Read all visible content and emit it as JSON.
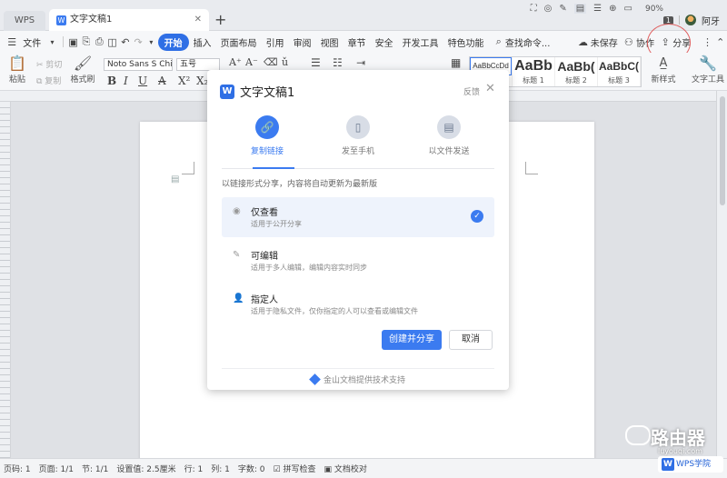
{
  "titlebar": {
    "app_tab": "WPS",
    "doc_tab": "文字文稿1",
    "new_tab": "+",
    "badge": "1",
    "user": "阿牙"
  },
  "menubar": {
    "file": "文件",
    "tabs": [
      "开始",
      "插入",
      "页面布局",
      "引用",
      "审阅",
      "视图",
      "章节",
      "安全",
      "开发工具",
      "特色功能"
    ],
    "search": "查找命令...",
    "unsaved": "未保存",
    "collab": "协作",
    "share": "分享"
  },
  "ribbon": {
    "paste": "粘贴",
    "cut": "剪切",
    "copy": "复制",
    "format_painter": "格式刷",
    "font": "Noto Sans S Chir",
    "size": "五号",
    "styles": [
      {
        "preview": "AaBbCcDd",
        "caption": ""
      },
      {
        "preview": "AaBb",
        "caption": "标题 1"
      },
      {
        "preview": "AaBb(",
        "caption": "标题 2"
      },
      {
        "preview": "AaBbC(",
        "caption": "标题 3"
      }
    ],
    "new_style": "新样式",
    "text_tools": "文字工具"
  },
  "dialog": {
    "title": "文字文稿1",
    "feedback": "反馈",
    "modes": [
      "复制链接",
      "发至手机",
      "以文件发送"
    ],
    "hint": "以链接形式分享，内容将自动更新为最新版",
    "options": [
      {
        "title": "仅查看",
        "desc": "适用于公开分享"
      },
      {
        "title": "可编辑",
        "desc": "适用于多人编辑，编辑内容实时同步"
      },
      {
        "title": "指定人",
        "desc": "适用于隐私文件，仅你指定的人可以查看或编辑文件"
      }
    ],
    "create_button": "创建并分享",
    "cancel_button": "取消",
    "footer": "金山文档提供技术支持"
  },
  "statusbar": {
    "items": [
      "页码: 1",
      "页面: 1/1",
      "节: 1/1",
      "设置值: 2.5厘米",
      "行: 1",
      "列: 1",
      "字数: 0",
      "拼写检查",
      "文档校对"
    ],
    "zoom": "90%"
  },
  "watermark": {
    "title": "路由器",
    "site": "luyouqi.com",
    "brand": "WPS学院"
  }
}
